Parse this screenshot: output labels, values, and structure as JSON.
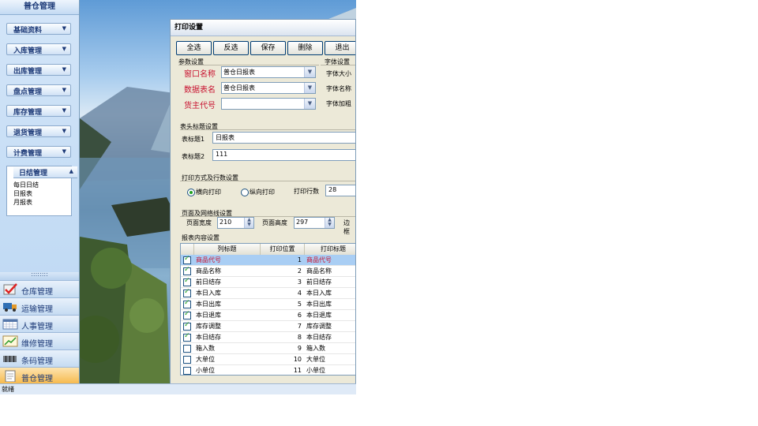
{
  "app": {
    "title": "普仓管理",
    "status": "就绪"
  },
  "nav": {
    "categories": [
      "基础资料",
      "入库管理",
      "出库管理",
      "盘点管理",
      "库存管理",
      "退货管理",
      "计费管理"
    ],
    "expanded": {
      "label": "日结管理",
      "items": [
        "每日日结",
        "日报表",
        "月报表"
      ]
    },
    "grip": "::::::::",
    "modules": [
      {
        "label": "仓库管理",
        "icon": "checkmark-clipboard-icon",
        "active": false
      },
      {
        "label": "运输管理",
        "icon": "truck-icon",
        "active": false
      },
      {
        "label": "人事管理",
        "icon": "calendar-icon",
        "active": false
      },
      {
        "label": "维修管理",
        "icon": "chart-icon",
        "active": false
      },
      {
        "label": "条码管理",
        "icon": "barcode-icon",
        "active": false
      },
      {
        "label": "普仓管理",
        "icon": "document-icon",
        "active": true
      }
    ]
  },
  "dialog": {
    "title": "打印设置",
    "toolbar": [
      "全选",
      "反选",
      "保存",
      "删除",
      "退出"
    ],
    "params": {
      "group": "参数设置",
      "window_name": {
        "label": "窗口名称",
        "value": "普仓日报表"
      },
      "table_name": {
        "label": "数据表名",
        "value": "普仓日报表"
      },
      "owner_code": {
        "label": "货主代号",
        "value": ""
      }
    },
    "font": {
      "group": "字体设置",
      "size": "字体大小",
      "name": "字体名称",
      "bold": "字体加粗"
    },
    "header": {
      "group": "表头标题设置",
      "title1": {
        "label": "表标题1",
        "value": "日报表"
      },
      "title2": {
        "label": "表标题2",
        "value": "111"
      }
    },
    "print": {
      "group": "打印方式及行数设置",
      "landscape": "横向打印",
      "portrait": "纵向打印",
      "rows_label": "打印行数",
      "rows_value": "28",
      "selected": "landscape"
    },
    "page": {
      "group": "页面及网络线设置",
      "width_label": "页面宽度",
      "width_value": "210",
      "height_label": "页面高度",
      "height_value": "297",
      "border_label": "边框"
    },
    "content": {
      "group": "报表内容设置",
      "columns": [
        "列标题",
        "打印位置",
        "打印标题"
      ],
      "rows": [
        {
          "checked": true,
          "title": "商品代号",
          "pos": "1",
          "print": "商品代号",
          "selected": true
        },
        {
          "checked": true,
          "title": "商品名称",
          "pos": "2",
          "print": "商品名称",
          "selected": false
        },
        {
          "checked": true,
          "title": "前日结存",
          "pos": "3",
          "print": "前日结存",
          "selected": false
        },
        {
          "checked": true,
          "title": "本日入库",
          "pos": "4",
          "print": "本日入库",
          "selected": false
        },
        {
          "checked": true,
          "title": "本日出库",
          "pos": "5",
          "print": "本日出库",
          "selected": false
        },
        {
          "checked": true,
          "title": "本日退库",
          "pos": "6",
          "print": "本日退库",
          "selected": false
        },
        {
          "checked": true,
          "title": "库存调整",
          "pos": "7",
          "print": "库存调整",
          "selected": false
        },
        {
          "checked": true,
          "title": "本日结存",
          "pos": "8",
          "print": "本日结存",
          "selected": false
        },
        {
          "checked": false,
          "title": "箱入数",
          "pos": "9",
          "print": "箱入数",
          "selected": false
        },
        {
          "checked": false,
          "title": "大单位",
          "pos": "10",
          "print": "大单位",
          "selected": false
        },
        {
          "checked": false,
          "title": "小单位",
          "pos": "11",
          "print": "小单位",
          "selected": false
        }
      ]
    }
  },
  "colors": {
    "nav_text": "#1d3a78",
    "required_label": "#c8102e",
    "selected_row": "#a9cef4",
    "active_module": "#f6b84a"
  }
}
